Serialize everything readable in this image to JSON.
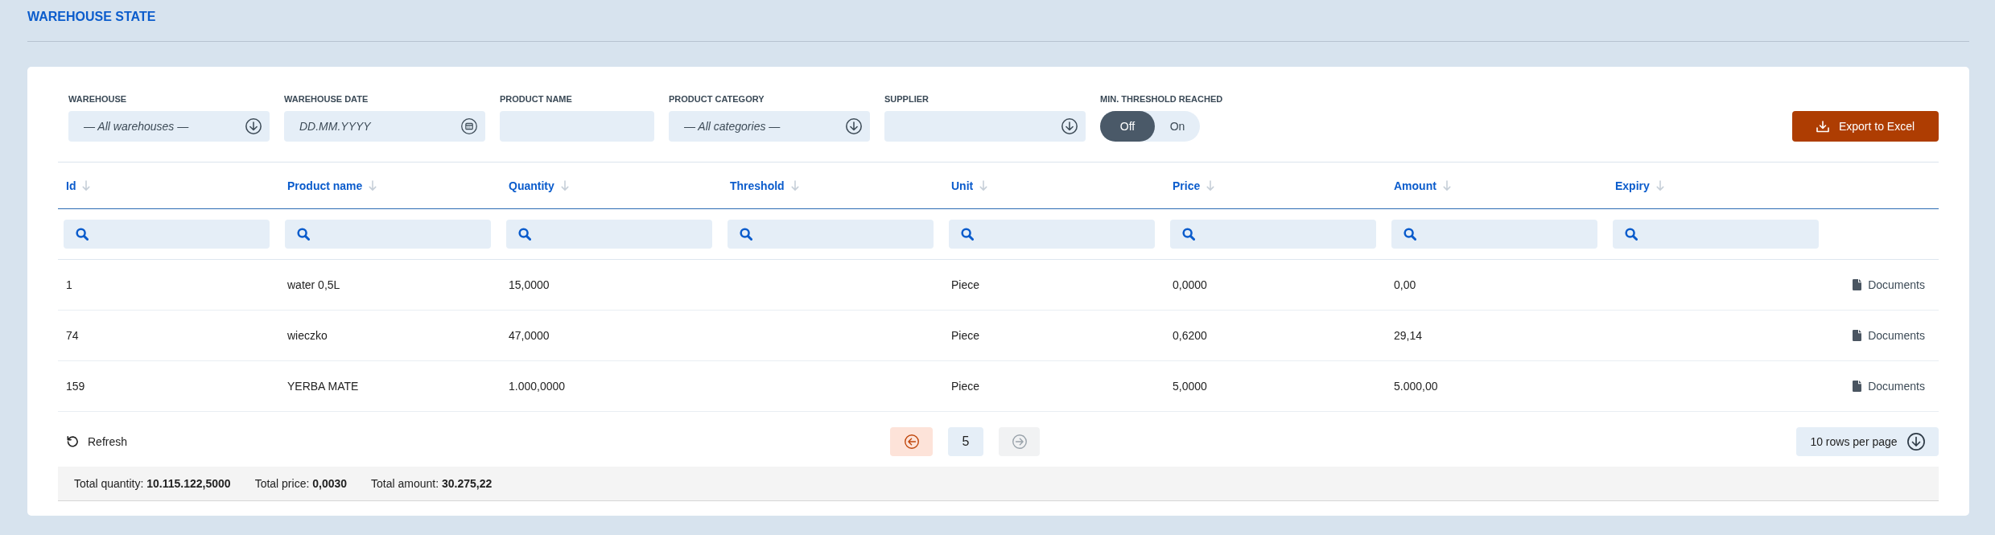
{
  "page": {
    "title": "WAREHOUSE STATE"
  },
  "filters": [
    {
      "kind": "select",
      "label": "WAREHOUSE",
      "value": "— All warehouses —"
    },
    {
      "kind": "date",
      "label": "WAREHOUSE DATE",
      "placeholder": "DD.MM.YYYY"
    },
    {
      "kind": "text",
      "label": "PRODUCT NAME"
    },
    {
      "kind": "select",
      "label": "PRODUCT CATEGORY",
      "value": "— All categories —"
    },
    {
      "kind": "select",
      "label": "SUPPLIER"
    },
    {
      "kind": "toggle",
      "label": "MIN. THRESHOLD REACHED",
      "options": [
        {
          "label": "Off",
          "selected": true
        },
        {
          "label": "On",
          "selected": false
        }
      ]
    }
  ],
  "export_button": {
    "label": "Export to Excel"
  },
  "table": {
    "columns": [
      "Id",
      "Product name",
      "Quantity",
      "Threshold",
      "Unit",
      "Price",
      "Amount",
      "Expiry"
    ],
    "rows": [
      {
        "id": "1",
        "product_name": "water 0,5L",
        "quantity": "15,0000",
        "unit": "Piece",
        "price": "0,0000",
        "amount": "0,00",
        "documents": "Documents"
      },
      {
        "id": "74",
        "product_name": "wieczko",
        "quantity": "47,0000",
        "unit": "Piece",
        "price": "0,6200",
        "amount": "29,14",
        "documents": "Documents"
      },
      {
        "id": "159",
        "product_name": "YERBA MATE",
        "quantity": "1.000,0000",
        "unit": "Piece",
        "price": "5,0000",
        "amount": "5.000,00",
        "documents": "Documents"
      }
    ]
  },
  "footer": {
    "refresh": "Refresh",
    "previous_page": {
      "disabled": false
    },
    "page": "5",
    "next_page": {
      "disabled": true
    },
    "rows_per_page": "10 rows per page"
  },
  "totals": [
    {
      "label": "Total quantity:",
      "value": "10.115.122,5000"
    },
    {
      "label": "Total price:",
      "value": "0,0030"
    },
    {
      "label": "Total amount:",
      "value": "30.275,22"
    }
  ]
}
